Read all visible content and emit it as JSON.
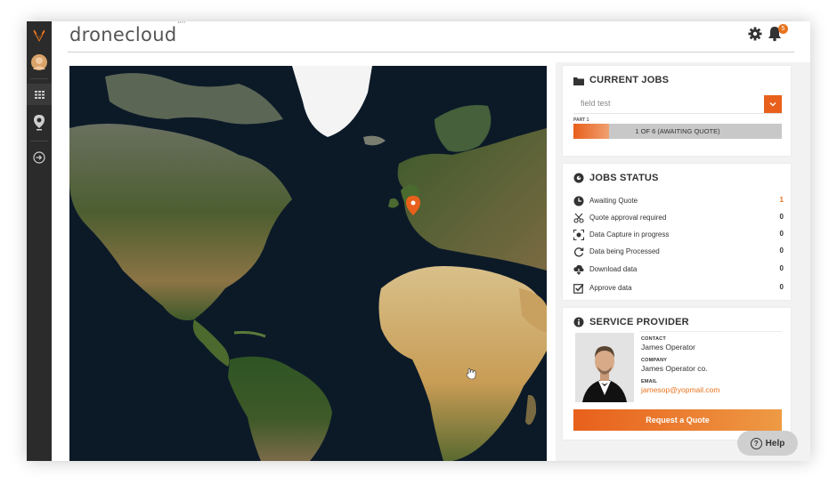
{
  "app": {
    "logo_text": "dronecloud",
    "logo_tm": "tm",
    "notification_count": "5"
  },
  "sidebar": {
    "items": [
      {
        "icon": "brand-wings-icon"
      },
      {
        "icon": "user-avatar"
      },
      {
        "icon": "grid-icon"
      },
      {
        "icon": "map-pin-icon"
      },
      {
        "icon": "logout-icon"
      }
    ]
  },
  "current_jobs": {
    "title": "CURRENT JOBS",
    "selected_job": "field test",
    "part_label": "PART 1",
    "progress_text": "1 OF 6 (AWAITING QUOTE)",
    "progress_fraction": 0.17
  },
  "jobs_status": {
    "title": "JOBS STATUS",
    "rows": [
      {
        "label": "Awaiting Quote",
        "count": "1",
        "icon": "clock-icon",
        "highlight": true
      },
      {
        "label": "Quote approval required",
        "count": "0",
        "icon": "scissors-icon",
        "highlight": false
      },
      {
        "label": "Data Capture in progress",
        "count": "0",
        "icon": "camera-frame-icon",
        "highlight": false
      },
      {
        "label": "Data being Processed",
        "count": "0",
        "icon": "refresh-icon",
        "highlight": false
      },
      {
        "label": "Download data",
        "count": "0",
        "icon": "cloud-download-icon",
        "highlight": false
      },
      {
        "label": "Approve data",
        "count": "0",
        "icon": "checkbox-icon",
        "highlight": false
      }
    ]
  },
  "service_provider": {
    "title": "SERVICE PROVIDER",
    "contact_label": "CONTACT",
    "contact": "James Operator",
    "company_label": "COMPANY",
    "company": "James Operator co.",
    "email_label": "EMAIL",
    "email": "jamesop@yopmail.com",
    "quote_button": "Request a Quote"
  },
  "help": {
    "label": "Help",
    "icon_glyph": "?"
  },
  "colors": {
    "accent": "#e8731e",
    "sidebar": "#2b2b2b",
    "panel_bg": "#f2f2f2"
  }
}
